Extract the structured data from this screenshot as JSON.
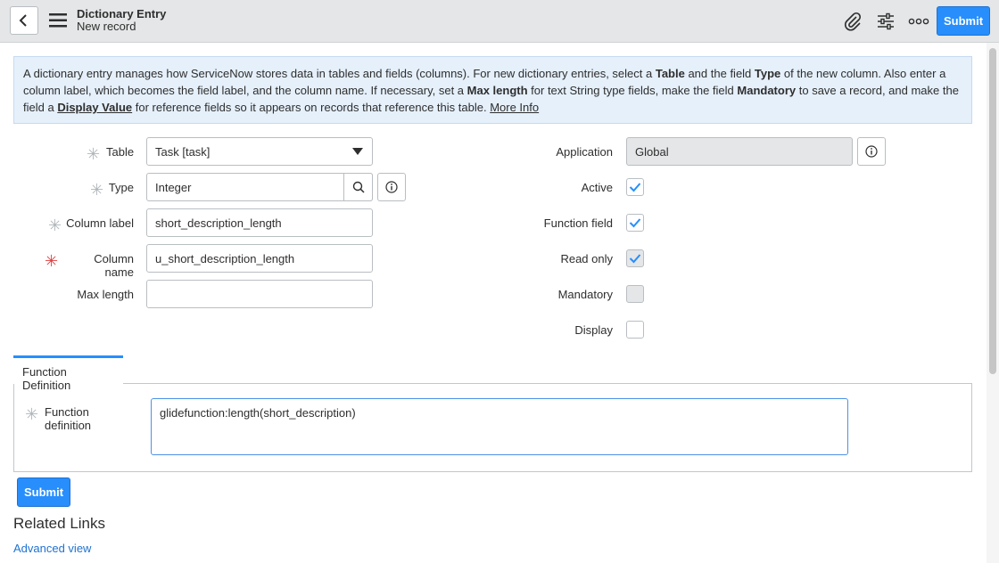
{
  "header": {
    "title": "Dictionary Entry",
    "subtitle": "New record",
    "submit_label": "Submit",
    "icons": [
      "back-icon",
      "hamburger-menu-icon",
      "paperclip-icon",
      "sliders-icon",
      "more-options-icon"
    ]
  },
  "info": {
    "part1": "A dictionary entry manages how ServiceNow stores data in tables and fields (columns). For new dictionary entries, select a ",
    "table_bold": "Table",
    "part2": " and the field ",
    "type_bold": "Type",
    "part3": " of the new column. Also enter a column label, which becomes the field label, and the column name. If necessary, set a ",
    "maxlen_bold": "Max length",
    "part4": " for text String type fields, make the field ",
    "mandatory_bold": "Mandatory",
    "part5": " to save a record, and make the field a ",
    "display_value": "Display Value",
    "part6": " for reference fields so it appears on records that reference this table. ",
    "more_info": "More Info"
  },
  "form": {
    "table_label": "Table",
    "table_value": "Task [task]",
    "type_label": "Type",
    "type_value": "Integer",
    "column_label_label": "Column label",
    "column_label_value": "short_description_length",
    "column_name_label": "Column name",
    "column_name_value": "u_short_description_length",
    "max_length_label": "Max length",
    "max_length_value": "",
    "application_label": "Application",
    "application_value": "Global",
    "active_label": "Active",
    "active_checked": true,
    "function_field_label": "Function field",
    "function_field_checked": true,
    "read_only_label": "Read only",
    "read_only_checked": true,
    "mandatory_label": "Mandatory",
    "mandatory_checked": false,
    "display_label": "Display",
    "display_checked": false
  },
  "function_section": {
    "tab_label": "Function Definition",
    "field_label": "Function definition",
    "field_value": "glidefunction:length(short_description)"
  },
  "footer": {
    "submit_label": "Submit",
    "related_links_title": "Related Links",
    "advanced_view_link": "Advanced view"
  },
  "colors": {
    "accent": "#278efc",
    "required_asterisk": "#e04040",
    "info_bg": "#e5f0fb",
    "header_bg": "#e4e6e7"
  }
}
